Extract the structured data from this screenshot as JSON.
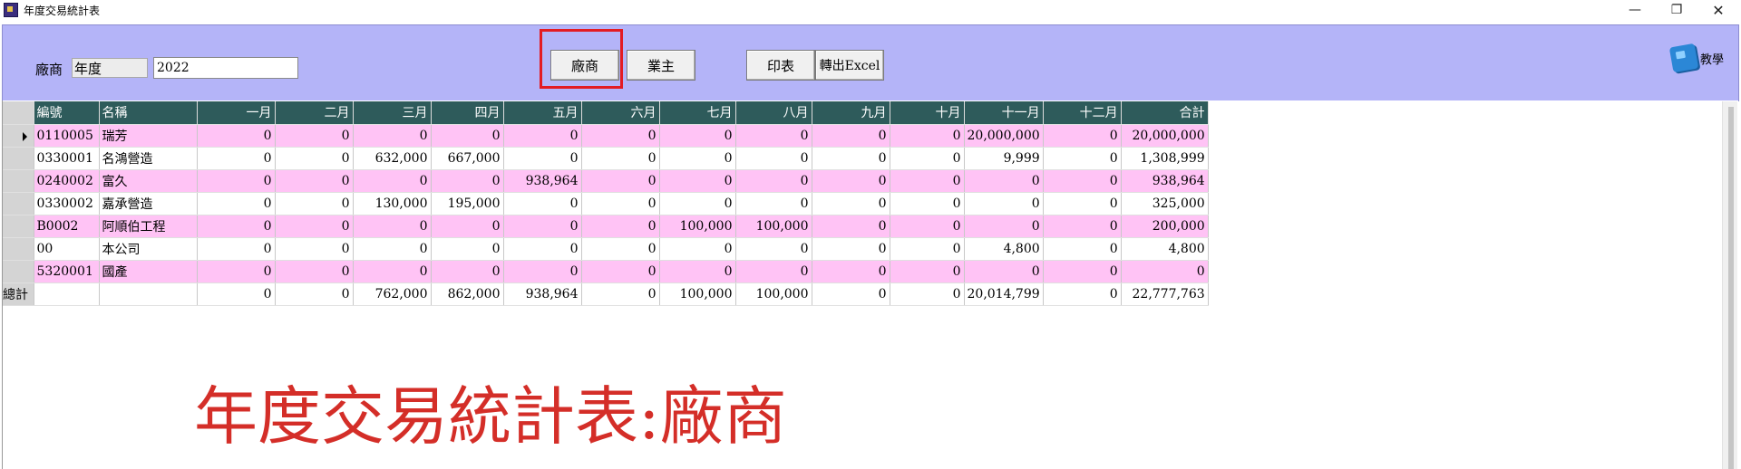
{
  "window": {
    "title": "年度交易統計表",
    "minimize": "—",
    "maximize": "❐",
    "close": "✕"
  },
  "toolbar": {
    "vendor_label": "廠商",
    "period_select": "年度",
    "year_value": "2022",
    "btn_vendor": "廠商",
    "btn_owner": "業主",
    "btn_print": "印表",
    "btn_excel": "轉出Excel",
    "teach_label": "教學",
    "highlight_color": "#e31b23"
  },
  "grid": {
    "columns": [
      "編號",
      "名稱",
      "一月",
      "二月",
      "三月",
      "四月",
      "五月",
      "六月",
      "七月",
      "八月",
      "九月",
      "十月",
      "十一月",
      "十二月",
      "合計"
    ],
    "rows": [
      [
        "0110005",
        "瑞芳",
        "0",
        "0",
        "0",
        "0",
        "0",
        "0",
        "0",
        "0",
        "0",
        "0",
        "20,000,000",
        "0",
        "20,000,000"
      ],
      [
        "0330001",
        "名鴻營造",
        "0",
        "0",
        "632,000",
        "667,000",
        "0",
        "0",
        "0",
        "0",
        "0",
        "0",
        "9,999",
        "0",
        "1,308,999"
      ],
      [
        "0240002",
        "富久",
        "0",
        "0",
        "0",
        "0",
        "938,964",
        "0",
        "0",
        "0",
        "0",
        "0",
        "0",
        "0",
        "938,964"
      ],
      [
        "0330002",
        "嘉承營造",
        "0",
        "0",
        "130,000",
        "195,000",
        "0",
        "0",
        "0",
        "0",
        "0",
        "0",
        "0",
        "0",
        "325,000"
      ],
      [
        "B0002",
        "阿順伯工程",
        "0",
        "0",
        "0",
        "0",
        "0",
        "0",
        "100,000",
        "100,000",
        "0",
        "0",
        "0",
        "0",
        "200,000"
      ],
      [
        "00",
        "本公司",
        "0",
        "0",
        "0",
        "0",
        "0",
        "0",
        "0",
        "0",
        "0",
        "0",
        "4,800",
        "0",
        "4,800"
      ],
      [
        "5320001",
        "國產",
        "0",
        "0",
        "0",
        "0",
        "0",
        "0",
        "0",
        "0",
        "0",
        "0",
        "0",
        "0",
        "0"
      ]
    ],
    "total_label": "總計",
    "totals": [
      "0",
      "0",
      "762,000",
      "862,000",
      "938,964",
      "0",
      "100,000",
      "100,000",
      "0",
      "0",
      "20,014,799",
      "0",
      "22,777,763"
    ],
    "colors": {
      "header": "#2e5b5b",
      "row_pink": "#ffc3f5",
      "row_white": "#ffffff"
    }
  },
  "caption": "年度交易統計表:廠商"
}
